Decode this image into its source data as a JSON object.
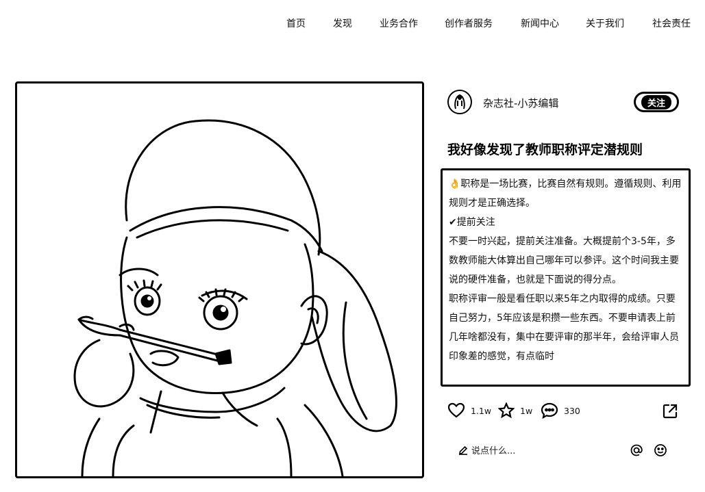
{
  "nav": {
    "items": [
      "首页",
      "发现",
      "业务合作",
      "创作者服务",
      "新闻中心",
      "关于我们",
      "社会责任"
    ]
  },
  "post": {
    "author": "杂志社-小苏编辑",
    "follow_label": "关注",
    "title": "我好像发现了教师职称评定潜规则",
    "paragraphs": [
      "👌职称是一场比赛，比赛自然有规则。遵循规则、利用规则才是正确选择。",
      "✔提前关注",
      "不要一时兴起，提前关注准备。大概提前个3-5年，多数教师能大体算出自己哪年可以参评。这个时间我主要说的硬件准备，也就是下面说的得分点。",
      "职称评审一般是看任职以来5年之内取得的成绩。只要自己努力，5年应该是积攒一些东西。不要申请表上前几年啥都没有，集中在要评审的那半年，会给评审人员印象差的感觉，有点临时"
    ]
  },
  "stats": {
    "likes": "1.1w",
    "favorites": "1w",
    "comments": "330"
  },
  "comment": {
    "placeholder": "说点什么..."
  },
  "icons": {
    "like": "heart-icon",
    "favorite": "star-icon",
    "comment": "chat-bubble-icon",
    "share": "share-icon",
    "edit": "pencil-icon",
    "mention": "at-icon",
    "emoji": "smiley-icon"
  }
}
